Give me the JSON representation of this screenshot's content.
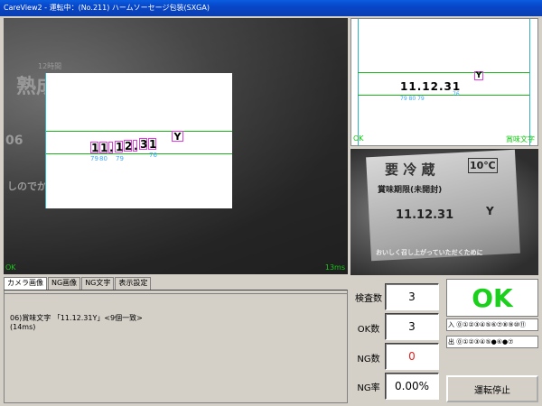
{
  "window": {
    "title": "CareView2 - 運転中：(No.211) ハームソーセージ包装(SXGA)"
  },
  "main_view": {
    "ghost_top": "12時間",
    "ghost_big": "熟成",
    "ghost_mid": "06",
    "ghost_side": "しのでか",
    "digits": [
      "1",
      "1",
      ".",
      "1",
      "2",
      ".",
      "3",
      "1"
    ],
    "check": "Y",
    "pos_label_1": "79",
    "pos_label_2": "80",
    "pos_label_3": "79",
    "pos_label_4": "76",
    "ok_label": "OK",
    "time_label": "13ms"
  },
  "ref_view": {
    "digits": "11.12.31",
    "check": "Y",
    "pos_label": "79 80  79",
    "pos_label_2": "76",
    "ok_label": "OK",
    "caption": "賞味文字"
  },
  "photo_view": {
    "heading": "要 冷 蔵",
    "temp": "10℃",
    "sub": "賞味期限(未開封)",
    "date": "11.12.31",
    "mark": "Y",
    "footer": "おいしく召し上がっていただくために"
  },
  "tabs": [
    "カメラ画像",
    "NG画像",
    "NG文字",
    "表示設定"
  ],
  "log": {
    "line1": "06)賞味文字 「11.12.31Y」<9個一致>",
    "line2": "(14ms)"
  },
  "stats": {
    "inspect_label": "検査数",
    "inspect_value": "3",
    "ok_label": "OK数",
    "ok_value": "3",
    "ng_label": "NG数",
    "ng_value": "0",
    "ngrate_label": "NG率",
    "ngrate_value": "0.00%"
  },
  "result": {
    "text": "OK",
    "color": "#1ad01a"
  },
  "io": {
    "in_label": "入 ⓪①②③④⑤⑥⑦⑧⑨⑩⑪",
    "out_label": "出 ⓪①②③④⑤●⑥●⑦"
  },
  "stop_button": "運転停止",
  "colors": {
    "ok_green": "#1ad01a",
    "ng_red": "#e02020",
    "titlebar": "#0a5ce0"
  }
}
